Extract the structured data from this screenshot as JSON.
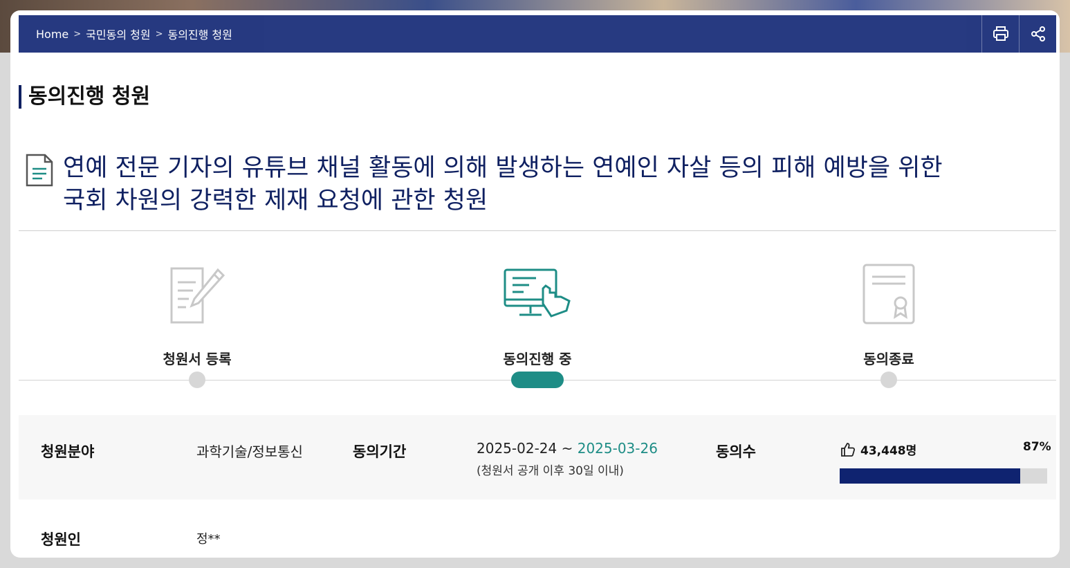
{
  "breadcrumb": {
    "home": "Home",
    "level1": "국민동의 청원",
    "level2": "동의진행 청원"
  },
  "toolbar": {
    "print_icon": "print-icon",
    "share_icon": "share-icon"
  },
  "page_title": "동의진행 청원",
  "petition": {
    "title_line1": "연예 전문 기자의 유튜브 채널 활동에 의해 발생하는 연예인 자살 등의 피해 예방을 위한",
    "title_line2": "국회 차원의 강력한 제재 요청에 관한 청원"
  },
  "steps": [
    {
      "label": "청원서 등록",
      "icon": "document-edit-icon",
      "active": false
    },
    {
      "label": "동의진행 중",
      "icon": "monitor-touch-icon",
      "active": true
    },
    {
      "label": "동의종료",
      "icon": "certificate-icon",
      "active": false
    }
  ],
  "info": {
    "field_label": "청원분야",
    "field_value": "과학기술/정보통신",
    "period_label": "동의기간",
    "period_start": "2025-02-24",
    "period_sep": " ~ ",
    "period_end": "2025-03-26",
    "period_note": "(청원서 공개 이후 30일 이내)",
    "count_label": "동의수",
    "count_value": "43,448명",
    "percent_text": "87%",
    "progress": 0.87,
    "petitioner_label": "청원인",
    "petitioner_value": "정**"
  },
  "colors": {
    "navy": "#0f2061",
    "teal": "#1e8d86",
    "bar": "#0f2370"
  }
}
